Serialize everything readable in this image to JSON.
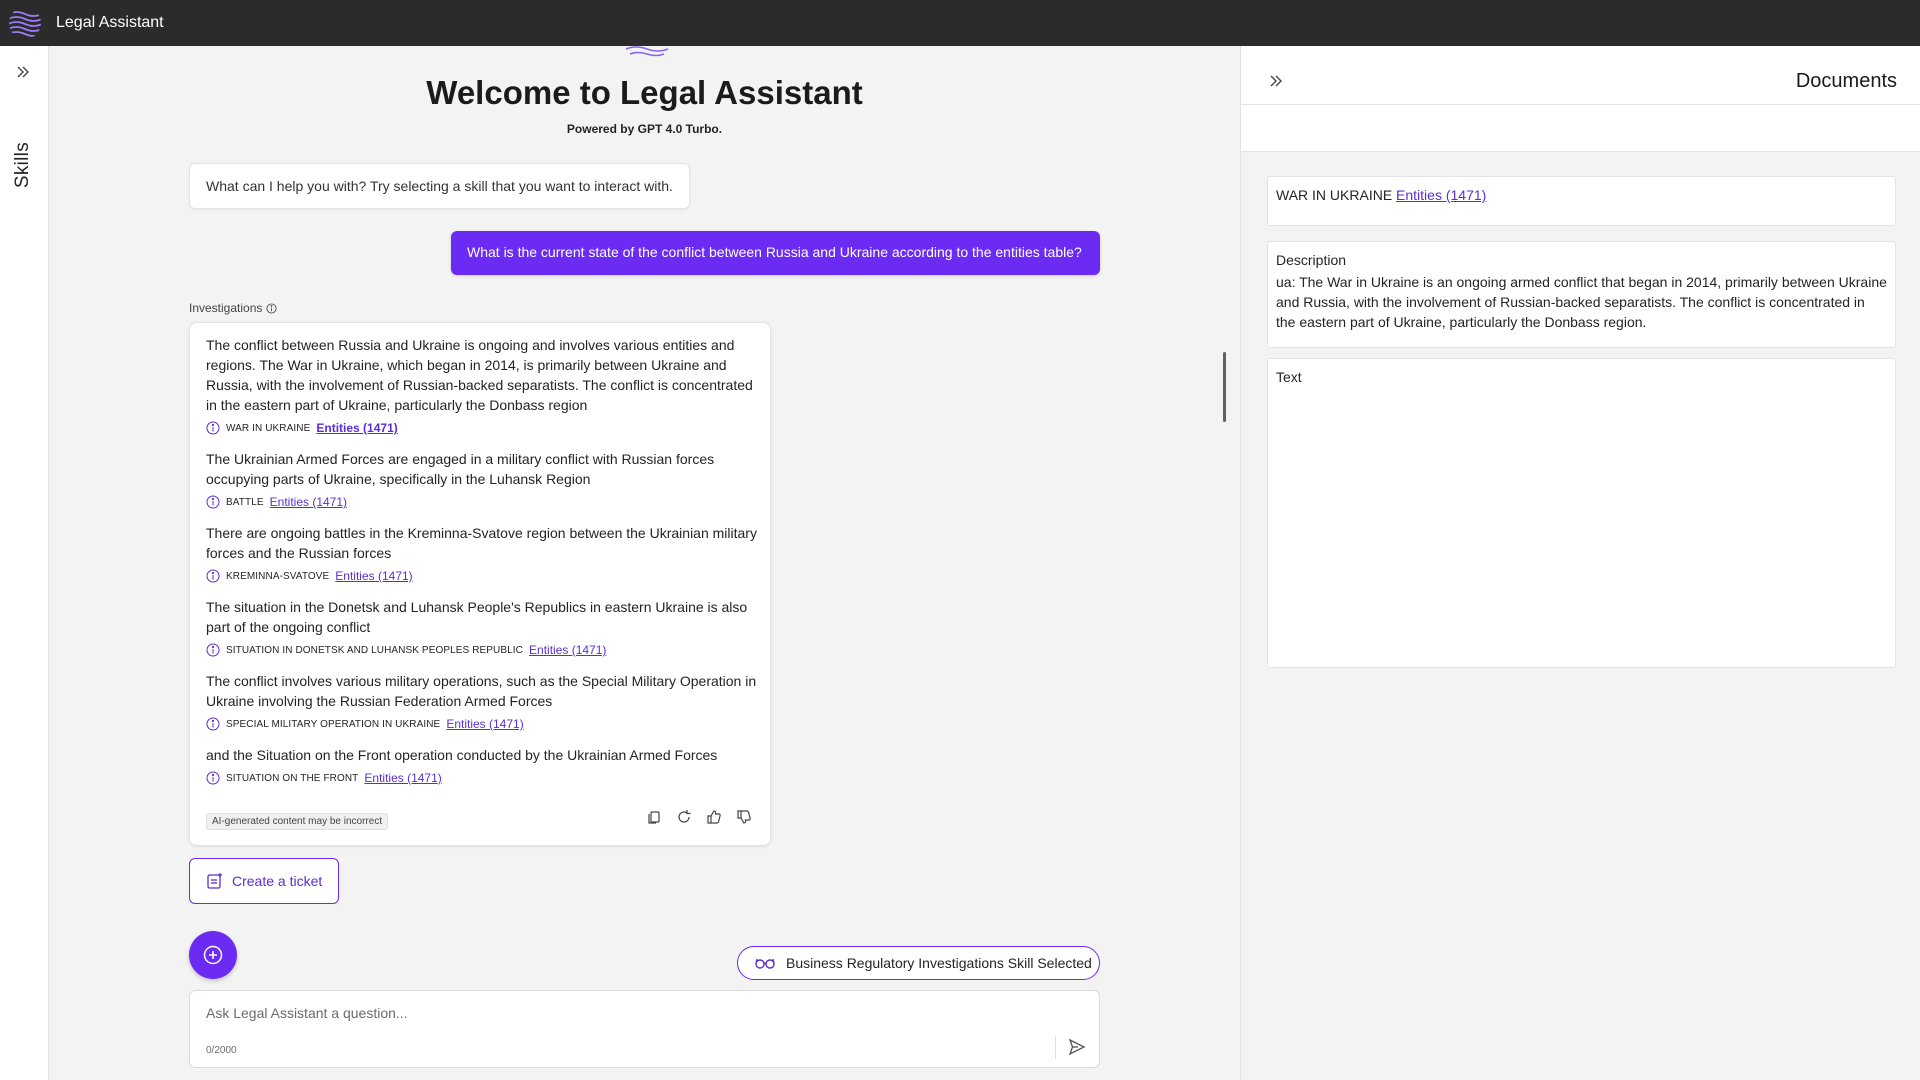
{
  "app": {
    "title": "Legal Assistant"
  },
  "rail": {
    "skills_label": "Skills"
  },
  "main": {
    "welcome": "Welcome to Legal Assistant",
    "powered_by": "Powered by GPT 4.0 Turbo.",
    "bot_greeting": "What can I help you with? Try selecting a skill that you want to interact with.",
    "user_message": "What is the current state of the conflict between Russia and Ukraine according to the entities table?",
    "investigations_label": "Investigations",
    "answers": [
      {
        "text": "The conflict between Russia and Ukraine is ongoing and involves various entities and regions. The War in Ukraine, which began in 2014, is primarily between Ukraine and Russia, with the involvement of Russian-backed separatists. The conflict is concentrated in the eastern part of Ukraine, particularly the Donbass region",
        "tag": "War in Ukraine",
        "link": "Entities (1471)"
      },
      {
        "text": "The Ukrainian Armed Forces are engaged in a military conflict with Russian forces occupying parts of Ukraine, specifically in the Luhansk Region",
        "tag": "Battle",
        "link": "Entities (1471)"
      },
      {
        "text": "There are ongoing battles in the Kreminna-Svatove region between the Ukrainian military forces and the Russian forces",
        "tag": "Kreminna-Svatove",
        "link": "Entities (1471)"
      },
      {
        "text": "The situation in the Donetsk and Luhansk People's Republics in eastern Ukraine is also part of the ongoing conflict",
        "tag": "Situation in Donetsk and Luhansk Peoples Republic",
        "link": "Entities (1471)"
      },
      {
        "text": "The conflict involves various military operations, such as the Special Military Operation in Ukraine involving the Russian Federation Armed Forces",
        "tag": "Special Military Operation in Ukraine",
        "link": "Entities (1471)"
      },
      {
        "text": "and the Situation on the Front operation conducted by the Ukrainian Armed Forces",
        "tag": "Situation on the Front",
        "link": "Entities (1471)"
      }
    ],
    "disclaimer": "AI-generated content may be incorrect",
    "create_ticket": "Create a ticket",
    "skill_selected": "Business Regulatory Investigations Skill Selected",
    "input": {
      "placeholder": "Ask Legal Assistant a question...",
      "value": "",
      "counter": "0/2000"
    }
  },
  "documents": {
    "title": "Documents",
    "entity_name": "WAR IN UKRAINE",
    "entity_link": "Entities (1471)",
    "description_label": "Description",
    "description": "ua: The War in Ukraine is an ongoing armed conflict that began in 2014, primarily between Ukraine and Russia, with the involvement of Russian-backed separatists. The conflict is concentrated in the eastern part of Ukraine, particularly the Donbass region.",
    "text_label": "Text"
  },
  "colors": {
    "accent": "#6b2bf2",
    "link": "#5b2dd6",
    "topbar": "#2b2b2b"
  }
}
